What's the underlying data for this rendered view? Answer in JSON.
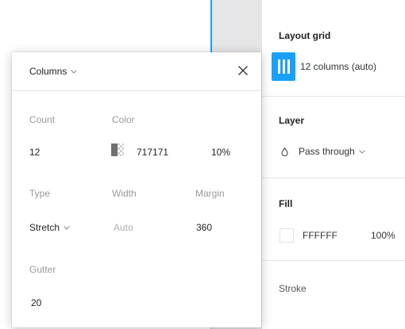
{
  "panel": {
    "layout_grid": {
      "title": "Layout grid",
      "grid_label": "12 columns (auto)"
    },
    "layer": {
      "title": "Layer",
      "blend_mode": "Pass through"
    },
    "fill": {
      "title": "Fill",
      "hex": "FFFFFF",
      "opacity": "100%"
    },
    "stroke": {
      "title": "Stroke"
    }
  },
  "popover": {
    "title": "Columns",
    "count_label": "Count",
    "count_value": "12",
    "color_label": "Color",
    "color_hex": "717171",
    "color_opacity": "10%",
    "type_label": "Type",
    "type_value": "Stretch",
    "width_label": "Width",
    "width_value": "Auto",
    "margin_label": "Margin",
    "margin_value": "360",
    "gutter_label": "Gutter",
    "gutter_value": "20"
  },
  "colors": {
    "accent": "#18a0fb",
    "grid_color": "#717171",
    "fill_color": "#FFFFFF"
  },
  "icons": {
    "grid": "columns-grid-icon",
    "close": "close-icon",
    "blend": "drop-icon",
    "dropdown": "chevron-down-icon"
  }
}
